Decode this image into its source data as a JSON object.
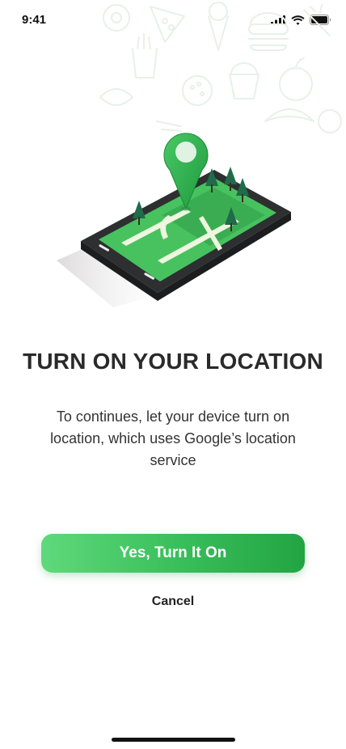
{
  "status_bar": {
    "time": "9:41",
    "icons": [
      "signal-icon",
      "wifi-icon",
      "battery-icon"
    ]
  },
  "background": {
    "doodle_color": "#e9f3ea"
  },
  "illustration": {
    "name": "phone-map-location-illustration",
    "pin_color": "#2ea84b",
    "map_color": "#47c25f"
  },
  "dialog": {
    "title": "TURN ON YOUR LOCATION",
    "description": "To continues, let your device turn on location, which uses Google’s location service",
    "primary_button": "Yes, Turn It On",
    "cancel_button": "Cancel"
  },
  "colors": {
    "accent_start": "#5fd97b",
    "accent_end": "#23a443",
    "text": "#2a2a2a"
  }
}
